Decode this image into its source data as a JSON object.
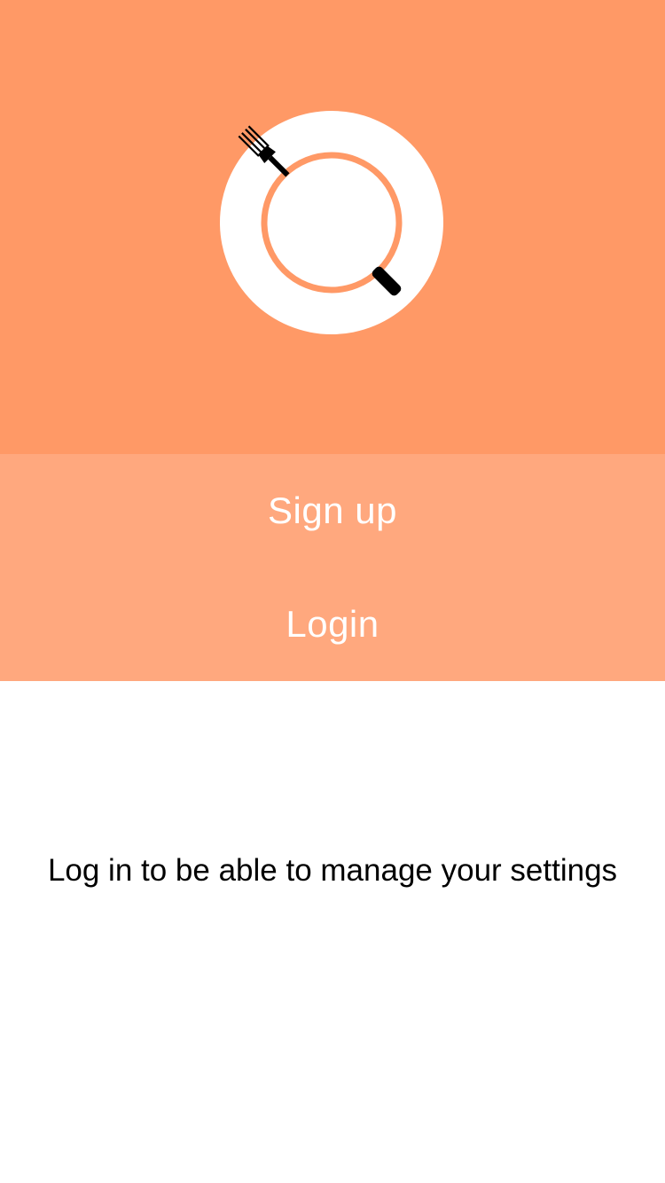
{
  "hero": {
    "logo_icon": "plate-fork-knife-icon",
    "background_color": "#FF9966"
  },
  "actions": {
    "signup_label": "Sign up",
    "login_label": "Login",
    "background_color": "#FFA87E"
  },
  "content": {
    "message": "Log in to be able to manage your settings"
  }
}
